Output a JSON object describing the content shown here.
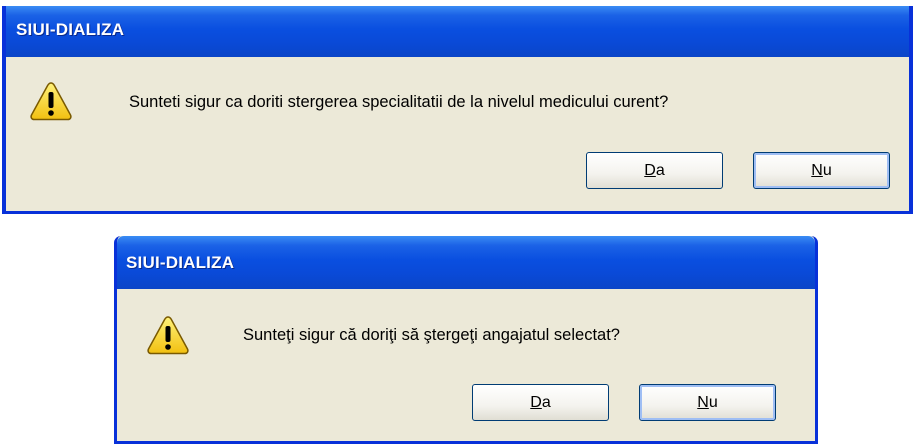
{
  "dialogs": [
    {
      "title": "SIUI-DIALIZA",
      "message": "Sunteti sigur ca doriti stergerea specialitatii de la nivelul medicului curent?",
      "buttons": [
        {
          "mnemonic": "D",
          "rest": "a"
        },
        {
          "mnemonic": "N",
          "rest": "u"
        }
      ]
    },
    {
      "title": "SIUI-DIALIZA",
      "message": "Sunteţi sigur că doriţi să ştergeţi angajatul selectat?",
      "buttons": [
        {
          "mnemonic": "D",
          "rest": "a"
        },
        {
          "mnemonic": "N",
          "rest": "u"
        }
      ]
    }
  ],
  "colors": {
    "titlebar": "#0a4fe0",
    "dialog_bg": "#ece9d8",
    "warning_yellow": "#f7d31c"
  },
  "icons": [
    "warning-icon"
  ]
}
